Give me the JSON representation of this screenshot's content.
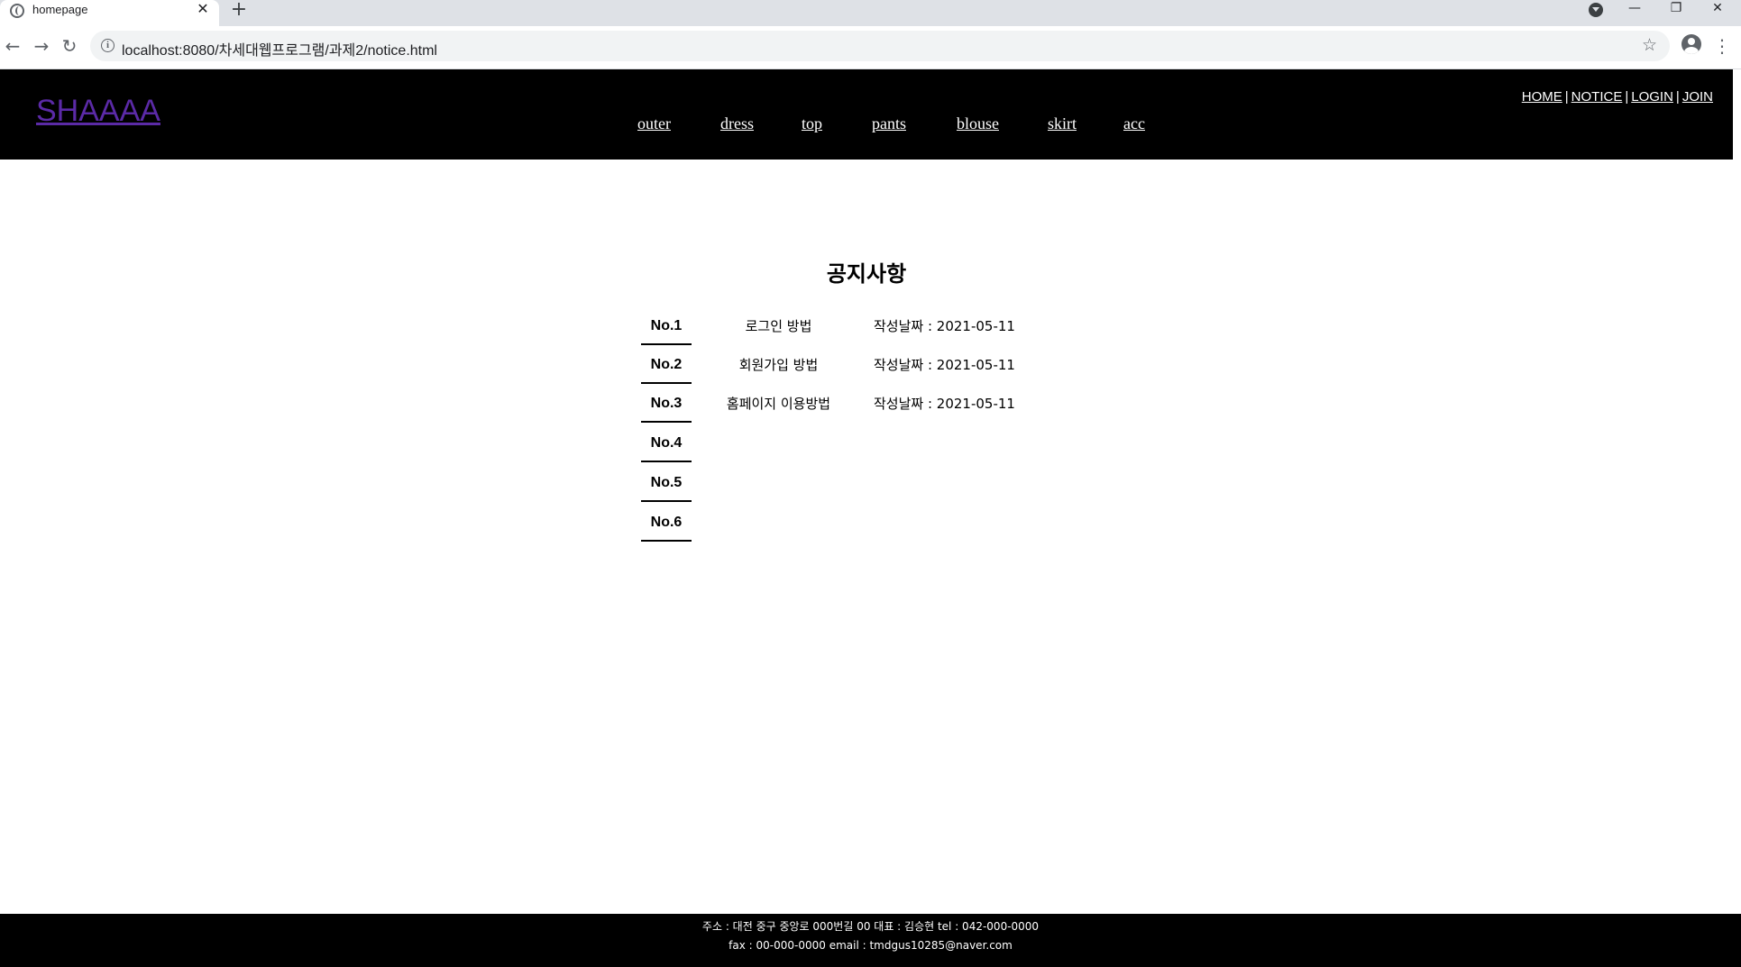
{
  "browser": {
    "tab_title": "homepage",
    "tab_close_glyph": "✕",
    "new_tab_glyph": "+",
    "url": "localhost:8080/차세대웹프로그램/과제2/notice.html",
    "window_minimize": "—",
    "window_restore": "❐",
    "window_close": "✕",
    "back_glyph": "←",
    "forward_glyph": "→",
    "reload_glyph": "↻",
    "info_glyph": "i",
    "star_glyph": "☆",
    "menu_glyph": "⋮"
  },
  "header": {
    "logo": "SHAAAA",
    "categories": [
      "outer",
      "dress",
      "top",
      "pants",
      "blouse",
      "skirt",
      "acc"
    ],
    "util_links": [
      "HOME",
      "NOTICE",
      "LOGIN",
      "JOIN"
    ],
    "util_separator": "|"
  },
  "notice": {
    "title": "공지사항",
    "rows": [
      {
        "no": "No.1",
        "subject": "로그인 방법",
        "date": "작성날짜 : 2021-05-11"
      },
      {
        "no": "No.2",
        "subject": "회원가입 방법",
        "date": "작성날짜 : 2021-05-11"
      },
      {
        "no": "No.3",
        "subject": "홈페이지 이용방법",
        "date": "작성날짜 : 2021-05-11"
      },
      {
        "no": "No.4",
        "subject": "",
        "date": ""
      },
      {
        "no": "No.5",
        "subject": "",
        "date": ""
      },
      {
        "no": "No.6",
        "subject": "",
        "date": ""
      }
    ]
  },
  "footer": {
    "line1": "주소 : 대전 중구 중앙로 000번길 00 대표 : 김승현 tel : 042-000-0000",
    "line2": "fax : 00-000-0000 email : tmdgus10285@naver.com"
  },
  "colors": {
    "header_bg": "#000000",
    "logo": "#5b2aa6",
    "footer_bg": "#000000"
  }
}
